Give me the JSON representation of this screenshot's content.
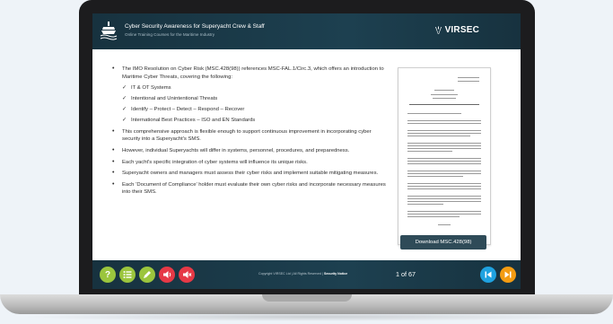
{
  "header": {
    "title": "Cyber Security Awareness for Superyacht Crew & Staff",
    "subtitle": "Online Training Courses for the Maritime Industry",
    "brand": "VIRSEC"
  },
  "content": {
    "intro_bullet": "The IMO Resolution on Cyber Risk (MSC.428(98)) references MSC-FAL.1/Circ.3, which offers an introduction to Maritime Cyber Threats, covering the following:",
    "checklist": [
      "IT & OT Systems",
      "Intentional and Unintentional Threats",
      "Identify – Protect – Detect – Respond – Recover",
      "International Best Practices – ISO and EN Standards"
    ],
    "bullets": [
      "This comprehensive approach is flexible enough to support continuous improvement in incorporating cyber security into a Superyacht's SMS.",
      "However, individual Superyachts will differ in systems, personnel, procedures, and preparedness.",
      "Each yacht's specific integration of cyber systems will influence its unique risks.",
      "Superyacht owners and managers must assess their cyber risks and implement suitable mitigating measures.",
      "Each ‘Document of Compliance’ holder must evaluate their own cyber risks and incorporate necessary measures into their SMS."
    ]
  },
  "download_button": "Download MSC.428(98)",
  "footer": {
    "copyright": "Copyright VIRSEC Ltd  |  All Rights Reserved  |",
    "security_notice": "Security Notice",
    "page_current": "1",
    "page_of": "of",
    "page_total": "67",
    "help_glyph": "?",
    "prev_glyph": "K",
    "next_glyph": "▶|"
  },
  "colors": {
    "header_bg": "#1a3a48",
    "help": "#9bc53d",
    "menu": "#9bc53d",
    "notes": "#9bc53d",
    "audio": "#e63946",
    "audio2": "#e63946",
    "prev": "#1fa2e0",
    "next": "#f39c12",
    "download_bg": "#2f4b58"
  }
}
